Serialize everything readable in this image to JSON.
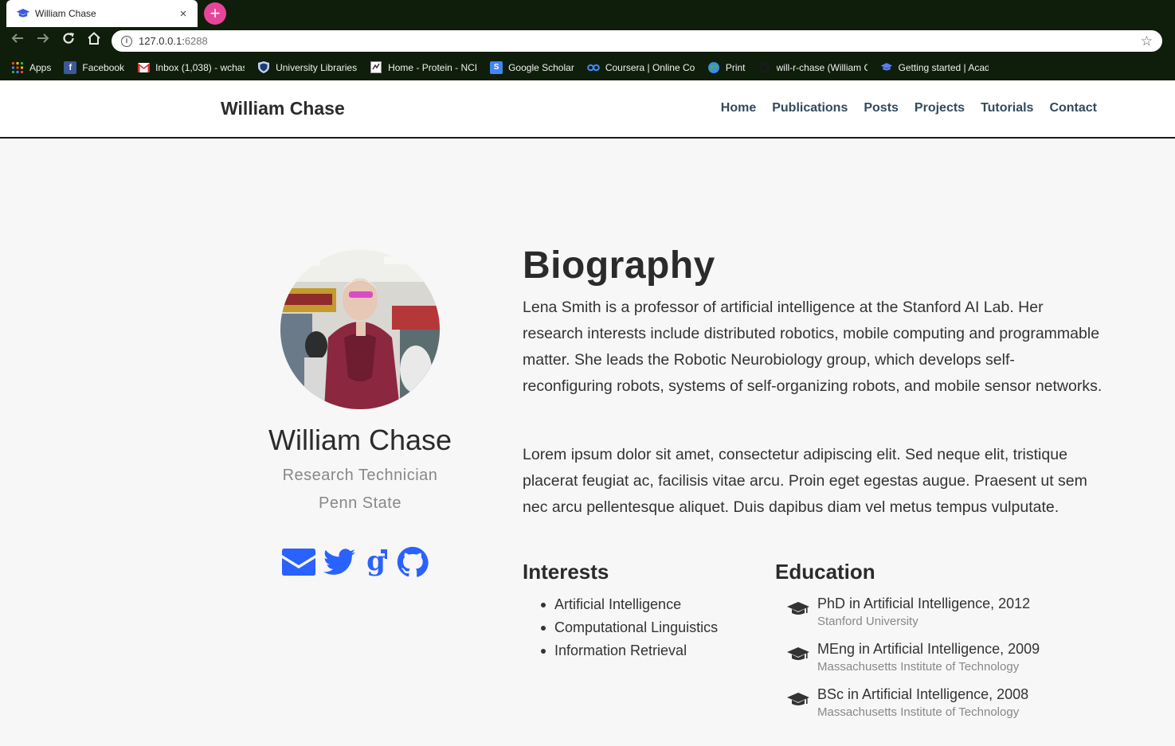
{
  "browser": {
    "tab_title": "William Chase",
    "tab_close": "×",
    "new_tab": "+",
    "url_host": "127.0.0.1:",
    "url_port": "6288",
    "bookmarks": [
      {
        "label": "Apps",
        "icon": "apps-grid-icon"
      },
      {
        "label": "Facebook",
        "icon": "facebook-icon"
      },
      {
        "label": "Inbox (1,038) - wchas",
        "icon": "gmail-icon"
      },
      {
        "label": "University Libraries",
        "icon": "shield-icon"
      },
      {
        "label": "Home - Protein - NCI",
        "icon": "page-icon"
      },
      {
        "label": "Google Scholar",
        "icon": "scholar-icon"
      },
      {
        "label": "Coursera | Online Cou",
        "icon": "coursera-icon"
      },
      {
        "label": "Print",
        "icon": "globe-icon"
      },
      {
        "label": "will-r-chase (William C",
        "icon": "github-icon"
      },
      {
        "label": "Getting started | Acad",
        "icon": "graduation-cap-icon"
      }
    ]
  },
  "site": {
    "brand": "William Chase",
    "nav": [
      "Home",
      "Publications",
      "Posts",
      "Projects",
      "Tutorials",
      "Contact"
    ]
  },
  "profile": {
    "name": "William Chase",
    "role": "Research Technician",
    "organization": "Penn State",
    "social": [
      "envelope-icon",
      "twitter-icon",
      "google-scholar-icon",
      "github-icon"
    ]
  },
  "biography": {
    "title": "Biography",
    "paragraphs": [
      "Lena Smith is a professor of artificial intelligence at the Stanford AI Lab. Her research interests include distributed robotics, mobile computing and programmable matter. She leads the Robotic Neurobiology group, which develops self-reconfiguring robots, systems of self-organizing robots, and mobile sensor networks.",
      "Lorem ipsum dolor sit amet, consectetur adipiscing elit. Sed neque elit, tristique placerat feugiat ac, facilisis vitae arcu. Proin eget egestas augue. Praesent ut sem nec arcu pellentesque aliquet. Duis dapibus diam vel metus tempus vulputate."
    ]
  },
  "interests": {
    "title": "Interests",
    "items": [
      "Artificial Intelligence",
      "Computational Linguistics",
      "Information Retrieval"
    ]
  },
  "education": {
    "title": "Education",
    "items": [
      {
        "degree": "PhD in Artificial Intelligence, 2012",
        "school": "Stanford University"
      },
      {
        "degree": "MEng in Artificial Intelligence, 2009",
        "school": "Massachusetts Institute of Technology"
      },
      {
        "degree": "BSc in Artificial Intelligence, 2008",
        "school": "Massachusetts Institute of Technology"
      }
    ]
  },
  "colors": {
    "accent": "#2962ff",
    "chrome": "#0f1e0a",
    "nav_link": "#34495e"
  }
}
